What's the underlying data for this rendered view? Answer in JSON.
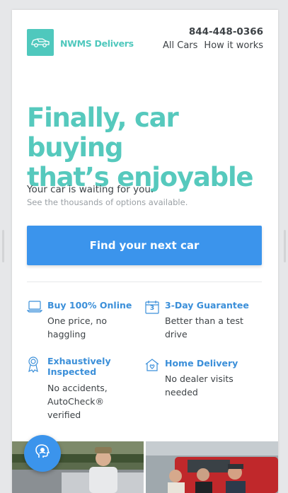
{
  "header": {
    "brand": "NWMS Delivers",
    "phone": "844-448-0366",
    "nav": [
      "All Cars",
      "How it works"
    ]
  },
  "hero": {
    "headline_line1": "Finally, car buying",
    "headline_line2": "that’s enjoyable",
    "subtitle": "Your car is waiting for you.",
    "subtitle_secondary": "See the thousands of options available.",
    "cta_label": "Find your next car"
  },
  "features": [
    {
      "icon": "laptop-icon",
      "title": "Buy 100% Online",
      "description": "One price, no haggling"
    },
    {
      "icon": "calendar-icon",
      "title": "3-Day Guarantee",
      "calendar_day": "3",
      "description": "Better than a test drive"
    },
    {
      "icon": "ribbon-icon",
      "title": "Exhaustively Inspected",
      "description": "No accidents, AutoCheck® verified"
    },
    {
      "icon": "home-heart-icon",
      "title": "Home Delivery",
      "description": "No dealer visits needed"
    }
  ],
  "chat": {
    "icon": "chat-person-icon"
  },
  "colors": {
    "brand_teal": "#4fc8bd",
    "headline_teal": "#56c9bd",
    "cta_blue": "#3b94ec",
    "feature_blue": "#3b8fd9",
    "text_dark": "#3d4246",
    "text_muted": "#9aa0a5"
  }
}
